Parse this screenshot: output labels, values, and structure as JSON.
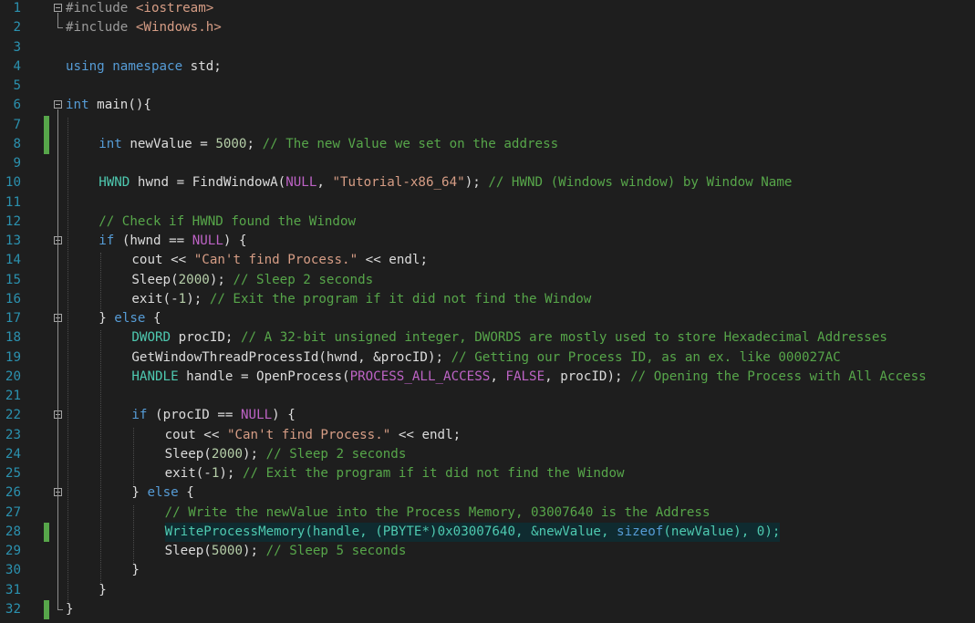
{
  "editor": {
    "colors": {
      "background": "#1e1e1e",
      "line_number": "#2b91af",
      "change_marker": "#57a64a",
      "current_line": "#0f2b30"
    },
    "lines": [
      {
        "n": "1",
        "indent": 0,
        "fold": true,
        "change": false,
        "tokens": [
          {
            "t": "#include ",
            "c": "pp"
          },
          {
            "t": "<iostream>",
            "c": "inc"
          }
        ]
      },
      {
        "n": "2",
        "indent": 0,
        "fold": false,
        "change": false,
        "tokens": [
          {
            "t": "#include ",
            "c": "pp"
          },
          {
            "t": "<Windows.h>",
            "c": "inc"
          }
        ]
      },
      {
        "n": "3",
        "indent": 0,
        "fold": false,
        "change": false,
        "tokens": []
      },
      {
        "n": "4",
        "indent": 0,
        "fold": false,
        "change": false,
        "tokens": [
          {
            "t": "using",
            "c": "kw"
          },
          {
            "t": " "
          },
          {
            "t": "namespace",
            "c": "kw"
          },
          {
            "t": " std;"
          }
        ]
      },
      {
        "n": "5",
        "indent": 0,
        "fold": false,
        "change": false,
        "tokens": []
      },
      {
        "n": "6",
        "indent": 0,
        "fold": true,
        "change": false,
        "tokens": [
          {
            "t": "int",
            "c": "kw"
          },
          {
            "t": " main(){"
          }
        ]
      },
      {
        "n": "7",
        "indent": 0,
        "fold": false,
        "change": true,
        "tokens": []
      },
      {
        "n": "8",
        "indent": 1,
        "fold": false,
        "change": true,
        "tokens": [
          {
            "t": "int",
            "c": "kw"
          },
          {
            "t": " newValue = "
          },
          {
            "t": "5000",
            "c": "num"
          },
          {
            "t": "; "
          },
          {
            "t": "// The new Value we set on the address",
            "c": "cm"
          }
        ]
      },
      {
        "n": "9",
        "indent": 0,
        "fold": false,
        "change": false,
        "tokens": []
      },
      {
        "n": "10",
        "indent": 1,
        "fold": false,
        "change": false,
        "tokens": [
          {
            "t": "HWND",
            "c": "ty"
          },
          {
            "t": " hwnd = FindWindowA("
          },
          {
            "t": "NULL",
            "c": "mac"
          },
          {
            "t": ", "
          },
          {
            "t": "\"Tutorial-x86_64\"",
            "c": "str"
          },
          {
            "t": "); "
          },
          {
            "t": "// HWND (Windows window) by Window Name",
            "c": "cm"
          }
        ]
      },
      {
        "n": "11",
        "indent": 0,
        "fold": false,
        "change": false,
        "tokens": []
      },
      {
        "n": "12",
        "indent": 1,
        "fold": false,
        "change": false,
        "tokens": [
          {
            "t": "// Check if HWND found the Window",
            "c": "cm"
          }
        ]
      },
      {
        "n": "13",
        "indent": 1,
        "fold": true,
        "change": false,
        "tokens": [
          {
            "t": "if",
            "c": "kw"
          },
          {
            "t": " (hwnd == "
          },
          {
            "t": "NULL",
            "c": "mac"
          },
          {
            "t": ") {"
          }
        ]
      },
      {
        "n": "14",
        "indent": 2,
        "fold": false,
        "change": false,
        "tokens": [
          {
            "t": "cout << "
          },
          {
            "t": "\"Can't find Process.\"",
            "c": "str"
          },
          {
            "t": " << endl;"
          }
        ]
      },
      {
        "n": "15",
        "indent": 2,
        "fold": false,
        "change": false,
        "tokens": [
          {
            "t": "Sleep("
          },
          {
            "t": "2000",
            "c": "num"
          },
          {
            "t": "); "
          },
          {
            "t": "// Sleep 2 seconds",
            "c": "cm"
          }
        ]
      },
      {
        "n": "16",
        "indent": 2,
        "fold": false,
        "change": false,
        "tokens": [
          {
            "t": "exit(-"
          },
          {
            "t": "1",
            "c": "num"
          },
          {
            "t": "); "
          },
          {
            "t": "// Exit the program if it did not find the Window",
            "c": "cm"
          }
        ]
      },
      {
        "n": "17",
        "indent": 1,
        "fold": true,
        "change": false,
        "tokens": [
          {
            "t": "} "
          },
          {
            "t": "else",
            "c": "kw"
          },
          {
            "t": " {"
          }
        ]
      },
      {
        "n": "18",
        "indent": 2,
        "fold": false,
        "change": false,
        "tokens": [
          {
            "t": "DWORD",
            "c": "ty"
          },
          {
            "t": " procID; "
          },
          {
            "t": "// A 32-bit unsigned integer, DWORDS are mostly used to store Hexadecimal Addresses",
            "c": "cm"
          }
        ]
      },
      {
        "n": "19",
        "indent": 2,
        "fold": false,
        "change": false,
        "tokens": [
          {
            "t": "GetWindowThreadProcessId(hwnd, &procID); "
          },
          {
            "t": "// Getting our Process ID, as an ex. like 000027AC",
            "c": "cm"
          }
        ]
      },
      {
        "n": "20",
        "indent": 2,
        "fold": false,
        "change": false,
        "tokens": [
          {
            "t": "HANDLE",
            "c": "ty"
          },
          {
            "t": " handle = OpenProcess("
          },
          {
            "t": "PROCESS_ALL_ACCESS",
            "c": "mac"
          },
          {
            "t": ", "
          },
          {
            "t": "FALSE",
            "c": "mac"
          },
          {
            "t": ", procID); "
          },
          {
            "t": "// Opening the Process with All Access",
            "c": "cm"
          }
        ]
      },
      {
        "n": "21",
        "indent": 0,
        "fold": false,
        "change": false,
        "tokens": []
      },
      {
        "n": "22",
        "indent": 2,
        "fold": true,
        "change": false,
        "tokens": [
          {
            "t": "if",
            "c": "kw"
          },
          {
            "t": " (procID == "
          },
          {
            "t": "NULL",
            "c": "mac"
          },
          {
            "t": ") {"
          }
        ]
      },
      {
        "n": "23",
        "indent": 3,
        "fold": false,
        "change": false,
        "tokens": [
          {
            "t": "cout << "
          },
          {
            "t": "\"Can't find Process.\"",
            "c": "str"
          },
          {
            "t": " << endl;"
          }
        ]
      },
      {
        "n": "24",
        "indent": 3,
        "fold": false,
        "change": false,
        "tokens": [
          {
            "t": "Sleep("
          },
          {
            "t": "2000",
            "c": "num"
          },
          {
            "t": "); "
          },
          {
            "t": "// Sleep 2 seconds",
            "c": "cm"
          }
        ]
      },
      {
        "n": "25",
        "indent": 3,
        "fold": false,
        "change": false,
        "tokens": [
          {
            "t": "exit(-"
          },
          {
            "t": "1",
            "c": "num"
          },
          {
            "t": "); "
          },
          {
            "t": "// Exit the program if it did not find the Window",
            "c": "cm"
          }
        ]
      },
      {
        "n": "26",
        "indent": 2,
        "fold": true,
        "change": false,
        "tokens": [
          {
            "t": "} "
          },
          {
            "t": "else",
            "c": "kw"
          },
          {
            "t": " {"
          }
        ]
      },
      {
        "n": "27",
        "indent": 3,
        "fold": false,
        "change": false,
        "tokens": [
          {
            "t": "// Write the newValue into the Process Memory, 03007640 is the Address",
            "c": "cm"
          }
        ]
      },
      {
        "n": "28",
        "indent": 3,
        "fold": false,
        "change": true,
        "highlight": true,
        "tokens": [
          {
            "t": "WriteProcessMemory(handle, (",
            "c": "ty"
          },
          {
            "t": "PBYTE",
            "c": "ty"
          },
          {
            "t": "*)0x03007640, &newValue, ",
            "c": "ty"
          },
          {
            "t": "sizeof",
            "c": "kw"
          },
          {
            "t": "(newValue), 0);",
            "c": "ty"
          }
        ]
      },
      {
        "n": "29",
        "indent": 3,
        "fold": false,
        "change": false,
        "tokens": [
          {
            "t": "Sleep("
          },
          {
            "t": "5000",
            "c": "num"
          },
          {
            "t": "); "
          },
          {
            "t": "// Sleep 5 seconds",
            "c": "cm"
          }
        ]
      },
      {
        "n": "30",
        "indent": 2,
        "fold": false,
        "change": false,
        "tokens": [
          {
            "t": "}"
          }
        ]
      },
      {
        "n": "31",
        "indent": 1,
        "fold": false,
        "change": false,
        "tokens": [
          {
            "t": "}"
          }
        ]
      },
      {
        "n": "32",
        "indent": 0,
        "fold": false,
        "change": true,
        "tokens": [
          {
            "t": "}"
          }
        ]
      }
    ]
  }
}
